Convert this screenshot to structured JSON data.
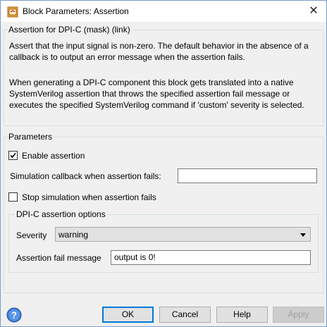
{
  "window": {
    "title": "Block Parameters: Assertion",
    "close_glyph": "✕"
  },
  "mask": {
    "header": "Assertion for DPI-C (mask) (link)",
    "description_1": "Assert that the input signal is non-zero. The default behavior in the absence of a callback is to output an error message when the assertion fails.",
    "description_2": "When generating a DPI-C component this block gets translated into a native SystemVerilog assertion that throws the specified assertion fail message or executes the specified SystemVerilog command if 'custom' severity is selected."
  },
  "parameters": {
    "header": "Parameters",
    "enable_assertion_label": "Enable assertion",
    "enable_assertion_checked": true,
    "sim_callback_label": "Simulation callback when assertion fails:",
    "sim_callback_value": "",
    "stop_sim_label": "Stop simulation when assertion fails",
    "stop_sim_checked": false
  },
  "dpic_options": {
    "header": "DPI-C assertion options",
    "severity_label": "Severity",
    "severity_value": "warning",
    "fail_message_label": "Assertion fail message",
    "fail_message_value": "output is 0!"
  },
  "buttons": {
    "ok": "OK",
    "cancel": "Cancel",
    "help": "Help",
    "apply": "Apply"
  },
  "icons": {
    "app": "simulink-block-icon",
    "help": "help-question-icon"
  },
  "colors": {
    "accent": "#0078d7",
    "group_border": "#d5dfe5",
    "help_blue": "#3a7bd5"
  }
}
